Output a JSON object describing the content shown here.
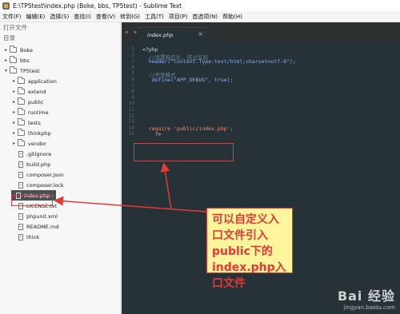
{
  "window": {
    "title": "E:\\TP5test\\index.php (Boke, bbs, TP5test) - Sublime Text"
  },
  "menu": [
    "文件(F)",
    "编辑(E)",
    "选择(S)",
    "查找(I)",
    "查看(V)",
    "转到(G)",
    "工具(T)",
    "项目(P)",
    "首选项(N)",
    "帮助(H)"
  ],
  "sidebar": {
    "open_files_label": "打开文件",
    "folders_label": "目录",
    "tree": [
      {
        "label": "Boke",
        "type": "folder",
        "expanded": false,
        "depth": 0
      },
      {
        "label": "bbs",
        "type": "folder",
        "expanded": false,
        "depth": 0
      },
      {
        "label": "TP5test",
        "type": "folder",
        "expanded": true,
        "depth": 0
      },
      {
        "label": "application",
        "type": "folder",
        "expanded": false,
        "depth": 1
      },
      {
        "label": "extend",
        "type": "folder",
        "expanded": false,
        "depth": 1
      },
      {
        "label": "public",
        "type": "folder",
        "expanded": false,
        "depth": 1
      },
      {
        "label": "runtime",
        "type": "folder",
        "expanded": false,
        "depth": 1
      },
      {
        "label": "tests",
        "type": "folder",
        "expanded": false,
        "depth": 1
      },
      {
        "label": "thinkphp",
        "type": "folder",
        "expanded": false,
        "depth": 1
      },
      {
        "label": "vendor",
        "type": "folder",
        "expanded": false,
        "depth": 1
      },
      {
        "label": ".gitignore",
        "type": "file",
        "depth": 1
      },
      {
        "label": "build.php",
        "type": "file",
        "depth": 1
      },
      {
        "label": "composer.json",
        "type": "file",
        "depth": 1
      },
      {
        "label": "composer.lock",
        "type": "file",
        "depth": 1
      },
      {
        "label": "index.php",
        "type": "file",
        "depth": 1,
        "selected": true
      },
      {
        "label": "LICENSE.txt",
        "type": "file",
        "depth": 1
      },
      {
        "label": "phpunit.xml",
        "type": "file",
        "depth": 1
      },
      {
        "label": "README.md",
        "type": "file",
        "depth": 1
      },
      {
        "label": "think",
        "type": "file",
        "depth": 1
      }
    ]
  },
  "editor": {
    "nav_arrows": "◂ ▸",
    "tab_label": "index.php",
    "tab_close": "×",
    "line_numbers": [
      "1",
      "2",
      "3",
      "4",
      "5",
      "6",
      "7",
      "8",
      "9",
      "10",
      "11",
      "12",
      "13",
      "14",
      "15"
    ],
    "lines": [
      "<?php",
      "  //设置响应头, 防止乱码",
      "  header(\"Content-Type:text/html;charset=utf-8\");",
      "",
      "  //开发模式",
      "   define(\"APP_DEBUG\", true);",
      "",
      "",
      "",
      "",
      "",
      "",
      "",
      "  require 'public/index.php';",
      "    ?>"
    ]
  },
  "annotation": {
    "callout_text": "可以自定义入口文件引入public下的index.php入口文件"
  },
  "watermark": {
    "brand": "Bai 经验",
    "url": "jingyan.baidu.com"
  },
  "colors": {
    "editor_bg": "#263238",
    "annotation_red": "#e53935",
    "callout_bg": "#fff59d"
  }
}
